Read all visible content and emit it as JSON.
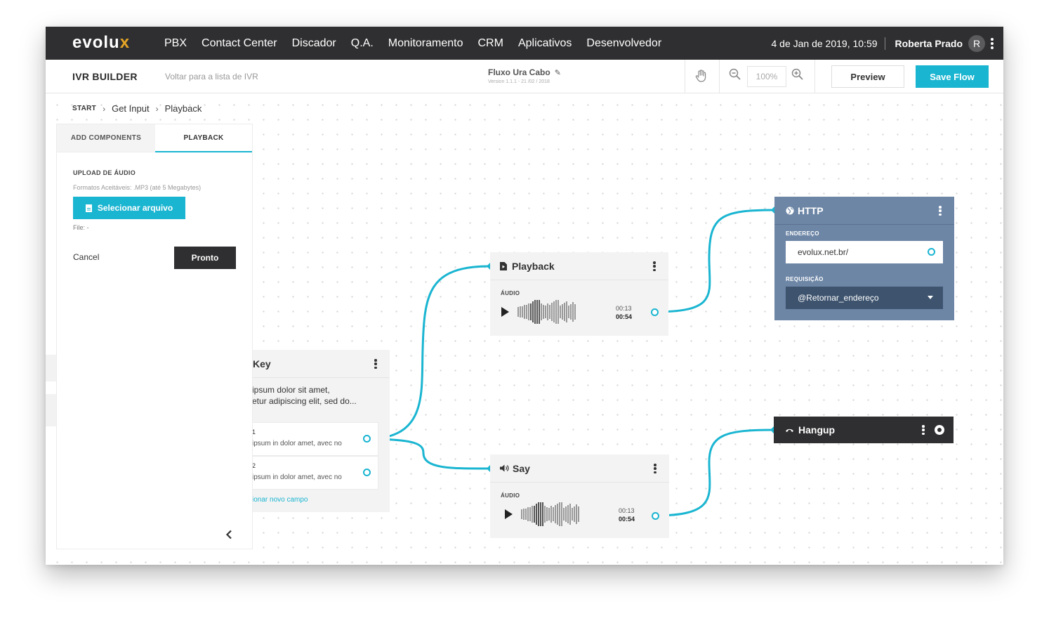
{
  "topnav": {
    "logo": "evolu",
    "logo_x": "x",
    "items": [
      "PBX",
      "Contact Center",
      "Discador",
      "Q.A.",
      "Monitoramento",
      "CRM",
      "Aplicativos",
      "Desenvolvedor"
    ],
    "date": "4 de Jan de 2019, 10:59",
    "user": "Roberta Prado",
    "avatar": "R"
  },
  "toolbar": {
    "title": "IVR BUILDER",
    "back": "Voltar para a lista de IVR",
    "flow_name": "Fluxo Ura Cabo",
    "version": "Version 1.1.1 - 21 /02 / 2018",
    "zoom": "100%",
    "preview": "Preview",
    "save": "Save Flow"
  },
  "breadcrumb": {
    "start": "START",
    "items": [
      "Get Input",
      "Playback"
    ]
  },
  "panel": {
    "tabs": [
      "ADD COMPONENTS",
      "PLAYBACK"
    ],
    "upload_label": "UPLOAD DE ÁUDIO",
    "formats": "Formatos Aceitáveis: .MP3 (até 5 Megabytes)",
    "select_button": "Selecionar arquivo",
    "file": "File:  -",
    "cancel": "Cancel",
    "done": "Pronto"
  },
  "nodes": {
    "playback": {
      "title": "Playback",
      "label": "ÁUDIO",
      "elapsed": "00:13",
      "total": "00:54"
    },
    "say": {
      "title": "Say",
      "label": "ÁUDIO",
      "elapsed": "00:13",
      "total": "00:54"
    },
    "http": {
      "title": "HTTP",
      "address_label": "ENDEREÇO",
      "address": "evolux.net.br/",
      "request_label": "REQUISIÇÃO",
      "request": "@Retornar_endereço"
    },
    "hangup": {
      "title": "Hangup"
    },
    "getinput": {
      "title": "Key",
      "desc1": "ipsum dolor sit amet,",
      "desc2": "etur adipiscing elit, sed do...",
      "opt1_title": "1",
      "opt1_desc": "ipsum in dolor amet, avec no",
      "opt2_title": "2",
      "opt2_desc": "ipsum in dolor amet, avec no",
      "add_field": "ionar novo campo"
    }
  },
  "colors": {
    "accent": "#1ab5d1",
    "nav": "#2f2f31",
    "http": "#6d86a6",
    "logo_x": "#e6a526"
  }
}
